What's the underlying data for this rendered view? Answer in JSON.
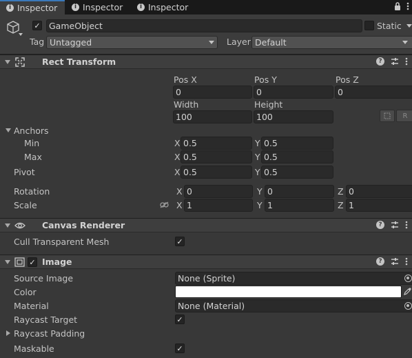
{
  "tabs": [
    {
      "label": "Inspector",
      "active": true
    },
    {
      "label": "Inspector",
      "active": false
    },
    {
      "label": "Inspector",
      "active": false
    }
  ],
  "tabbar_icons": [
    "lock-icon",
    "kebab-menu-icon"
  ],
  "gameobject": {
    "name": "GameObject",
    "active": true,
    "static_label": "Static",
    "tag_label": "Tag",
    "tag_value": "Untagged",
    "layer_label": "Layer",
    "layer_value": "Default"
  },
  "rect_transform": {
    "title": "Rect Transform",
    "pos_x_label": "Pos X",
    "pos_y_label": "Pos Y",
    "pos_z_label": "Pos Z",
    "pos_x": "0",
    "pos_y": "0",
    "pos_z": "0",
    "width_label": "Width",
    "height_label": "Height",
    "width": "100",
    "height": "100",
    "raw_button": "R",
    "anchors_label": "Anchors",
    "min_label": "Min",
    "max_label": "Max",
    "anchor_min_x": "0.5",
    "anchor_min_y": "0.5",
    "anchor_max_x": "0.5",
    "anchor_max_y": "0.5",
    "pivot_label": "Pivot",
    "pivot_x": "0.5",
    "pivot_y": "0.5",
    "rotation_label": "Rotation",
    "rotation_x": "0",
    "rotation_y": "0",
    "rotation_z": "0",
    "scale_label": "Scale",
    "scale_x": "1",
    "scale_y": "1",
    "scale_z": "1",
    "axis_x": "X",
    "axis_y": "Y",
    "axis_z": "Z"
  },
  "canvas_renderer": {
    "title": "Canvas Renderer",
    "cull_label": "Cull Transparent Mesh",
    "cull_checked": true
  },
  "image": {
    "title": "Image",
    "enabled": true,
    "source_image_label": "Source Image",
    "source_image_value": "None (Sprite)",
    "color_label": "Color",
    "color_value": "#ffffff",
    "material_label": "Material",
    "material_value": "None (Material)",
    "raycast_target_label": "Raycast Target",
    "raycast_target_checked": true,
    "raycast_padding_label": "Raycast Padding",
    "maskable_label": "Maskable",
    "maskable_checked": true
  },
  "check_glyph": "✓",
  "colors": {
    "background": "#383838",
    "tabbar": "#191919",
    "active_tab_accent": "#3a79bb",
    "field": "#2a2a2a"
  }
}
